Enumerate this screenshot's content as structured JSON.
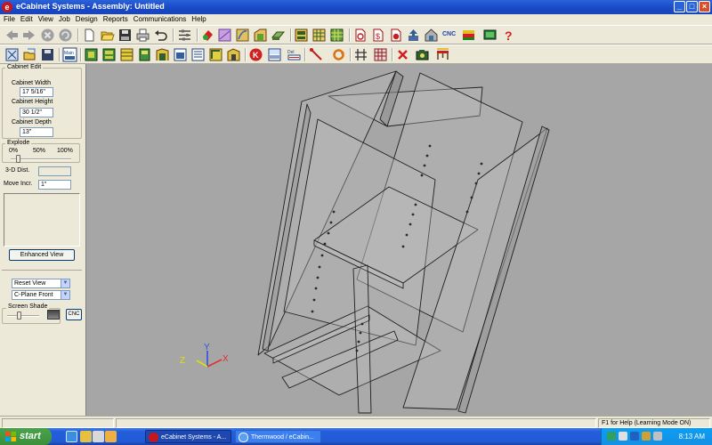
{
  "window": {
    "title": "eCabinet Systems - Assembly: Untitled",
    "controls": [
      "minimize",
      "maximize",
      "close"
    ]
  },
  "menu": [
    "File",
    "Edit",
    "View",
    "Job",
    "Design",
    "Reports",
    "Communications",
    "Help"
  ],
  "toolbar": {
    "cnc_label": "CNC",
    "row1_icons": [
      "back-arrow-icon",
      "forward-arrow-icon",
      "stop-icon",
      "refresh-icon",
      "new-document-icon",
      "open-folder-icon",
      "save-icon",
      "print-icon",
      "undo-icon",
      "properties-icon",
      "paint-icon",
      "part-icon",
      "cabinet-icon",
      "door-icon",
      "shelf-icon",
      "assembly-icon",
      "grid-icon",
      "report-icon",
      "dollar-report-icon",
      "schedule-report-icon",
      "upload-icon",
      "export-icon",
      "cnc-icon",
      "flag-icon",
      "monitor-icon",
      "help-icon"
    ],
    "row2_icons": [
      "new-design-icon",
      "open-design-icon",
      "save-design-icon",
      "main-view-icon",
      "cabinet-view-icon",
      "drawer-icon",
      "box-icon",
      "tower-icon",
      "wall-icon",
      "insert-icon",
      "view3d-icon",
      "corner-icon",
      "face-icon",
      "thermwood-icon",
      "sheet-icon",
      "delete-part-icon",
      "measure-icon",
      "rotate-icon",
      "grid-lines-icon",
      "hatch-icon",
      "delete-icon",
      "camera-icon",
      "table-icon"
    ]
  },
  "panel": {
    "cabinet_edit": "Cabinet Edit",
    "width_label": "Cabinet Width",
    "width_value": "17 5/16\"",
    "height_label": "Cabinet Height",
    "height_value": "30 1/2\"",
    "depth_label": "Cabinet Depth",
    "depth_value": "13\"",
    "explode": "Explode",
    "ticks": [
      "0%",
      "50%",
      "100%"
    ],
    "explode_fraction": 0.1,
    "dist_label": "3-D Dist.",
    "move_label": "Move Incr.",
    "move_value": "1\"",
    "enhanced": "Enhanced View",
    "reset_view": "Reset View",
    "cplane": "C-Plane Front",
    "screen_shade": "Screen Shade",
    "shade_fraction": 0.35,
    "cnc": "CNC"
  },
  "axes": {
    "x": "X",
    "y": "Y",
    "z": "Z",
    "x_color": "#e03030",
    "y_color": "#3050e0",
    "z_color": "#e0e000"
  },
  "status": {
    "help": "F1 for Help (Learning Mode ON)"
  },
  "taskbar": {
    "start": "start",
    "tasks": [
      "eCabinet Systems - A...",
      "Thermwood / eCabin..."
    ],
    "clock": "8:13 AM"
  }
}
